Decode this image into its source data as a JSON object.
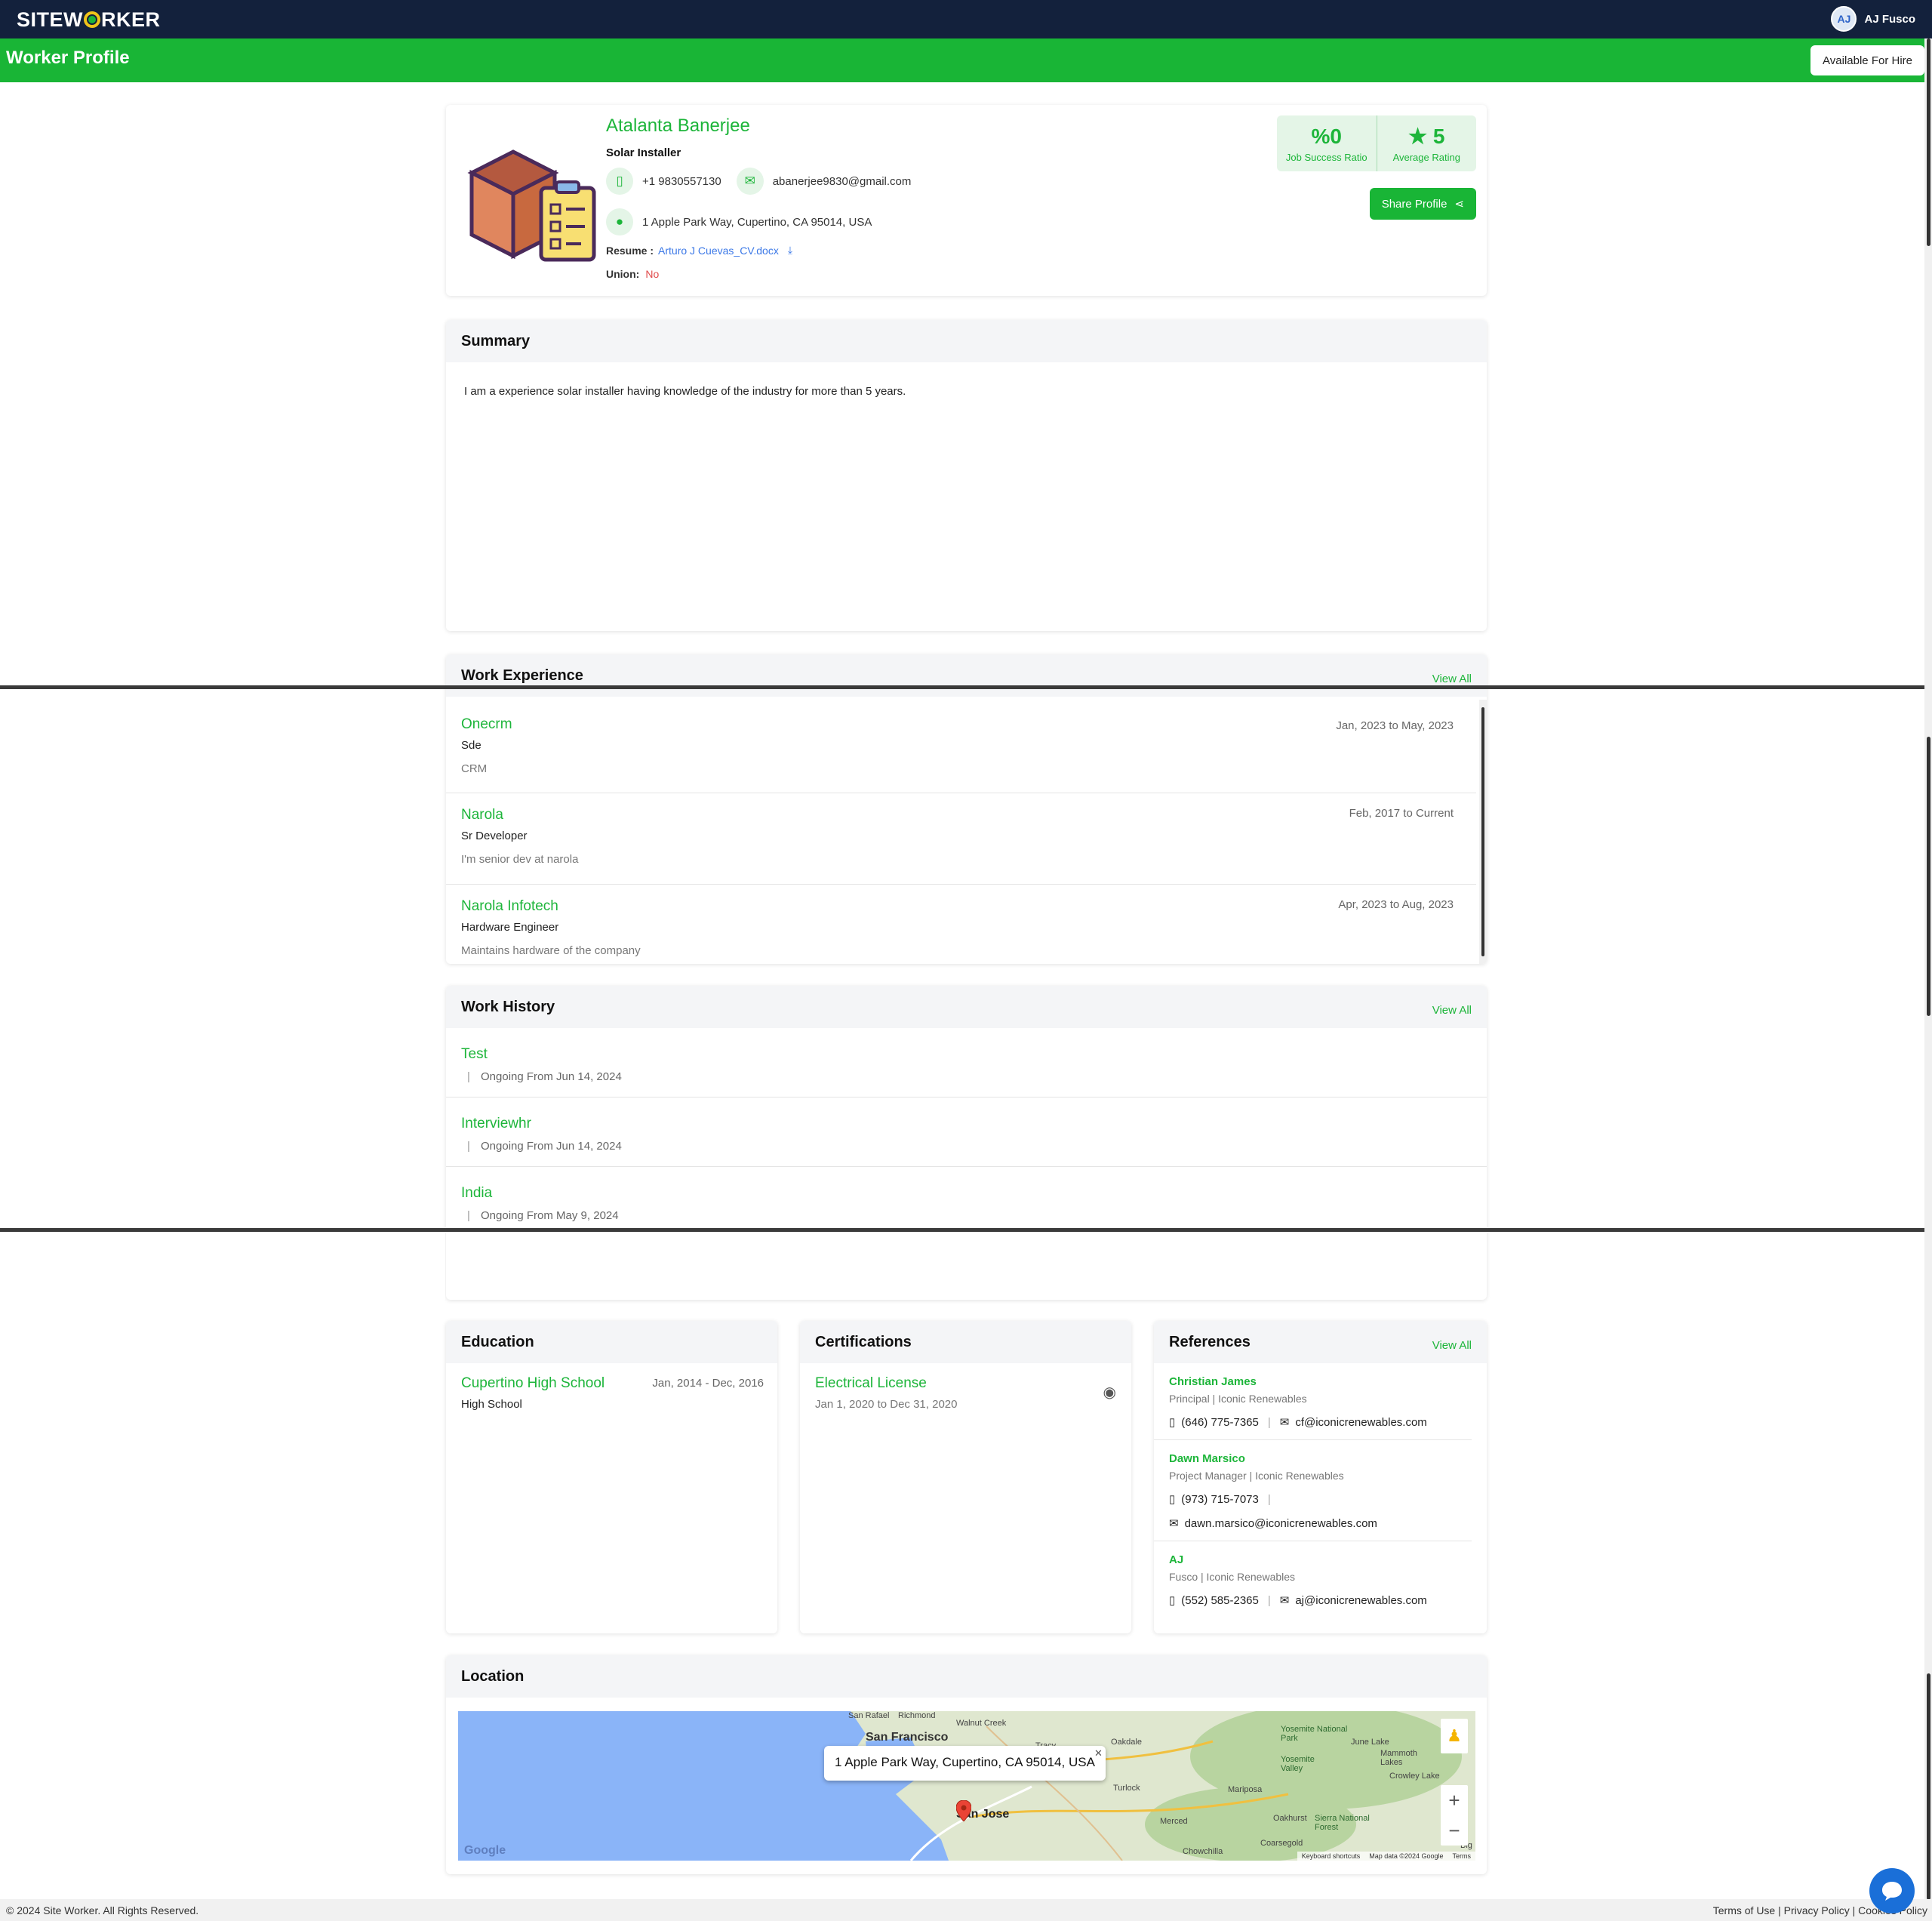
{
  "app": {
    "logo_text_1": "SITEW",
    "logo_text_2": "RKER",
    "user_name": "AJ Fusco",
    "user_initials": "AJ",
    "page_title": "Worker Profile",
    "availability": "Available For Hire",
    "accent_color": "#19b536"
  },
  "profile": {
    "name": "Atalanta Banerjee",
    "title": "Solar Installer",
    "phone": "+1 9830557130",
    "email": "abanerjee9830@gmail.com",
    "address": "1 Apple Park Way, Cupertino, CA 95014, USA",
    "resume_label": "Resume :",
    "resume_file": "Arturo J Cuevas_CV.docx",
    "union_label": "Union:",
    "union_value": "No",
    "job_success_value": "0",
    "job_success_label": "Job Success Ratio",
    "rating_value": "5",
    "rating_label": "Average Rating",
    "share_label": "Share Profile"
  },
  "summary": {
    "title": "Summary",
    "text": "I am a experience solar installer having knowledge of the industry for more than 5 years."
  },
  "work_experience": {
    "title": "Work Experience",
    "view_all": "View All",
    "items": [
      {
        "company": "Onecrm",
        "role": "Sde",
        "desc": "CRM",
        "dates": "Jan, 2023 to May, 2023"
      },
      {
        "company": "Narola",
        "role": "Sr Developer",
        "desc": "I'm senior dev at narola",
        "dates": "Feb, 2017 to Current"
      },
      {
        "company": "Narola Infotech",
        "role": "Hardware Engineer",
        "desc": "Maintains hardware of the company",
        "dates": "Apr, 2023 to Aug, 2023"
      }
    ]
  },
  "work_history": {
    "title": "Work History",
    "view_all": "View All",
    "items": [
      {
        "name": "Test",
        "status": "Ongoing From Jun 14, 2024"
      },
      {
        "name": "Interviewhr",
        "status": "Ongoing From Jun 14, 2024"
      },
      {
        "name": "India",
        "status": "Ongoing From May 9, 2024"
      }
    ]
  },
  "education": {
    "title": "Education",
    "items": [
      {
        "school": "Cupertino High School",
        "level": "High School",
        "dates": "Jan, 2014 - Dec, 2016"
      }
    ]
  },
  "certifications": {
    "title": "Certifications",
    "items": [
      {
        "name": "Electrical License",
        "dates": "Jan 1, 2020 to Dec 31, 2020"
      }
    ]
  },
  "references": {
    "title": "References",
    "view_all": "View All",
    "items": [
      {
        "name": "Christian James",
        "role": "Principal | Iconic Renewables",
        "phone": "(646) 775-7365",
        "email": "cf@iconicrenewables.com"
      },
      {
        "name": "Dawn Marsico",
        "role": "Project Manager | Iconic Renewables",
        "phone": "(973) 715-7073",
        "email": "dawn.marsico@iconicrenewables.com"
      },
      {
        "name": "AJ",
        "role": "Fusco | Iconic Renewables",
        "phone": "(552) 585-2365",
        "email": "aj@iconicrenewables.com"
      }
    ]
  },
  "location": {
    "title": "Location",
    "info_window": "1 Apple Park Way, Cupertino, CA 95014, USA",
    "map_labels": [
      "San Francisco",
      "San Jose",
      "Walnut Creek",
      "Tracy",
      "Oakdale",
      "Turlock",
      "Merced",
      "Mariposa",
      "Yosemite National Park",
      "Yosemite Valley",
      "June Lake",
      "Mammoth Lakes",
      "Crowley Lake",
      "Oakhurst",
      "Sierra National Forest",
      "Coarsegold",
      "Chowchilla",
      "San Rafael",
      "Richmond",
      "Big"
    ],
    "google_text": "Google",
    "map_footer": [
      "Keyboard shortcuts",
      "Map data ©2024 Google",
      "Terms"
    ]
  },
  "footer": {
    "copyright": "© 2024 Site Worker. All Rights Reserved.",
    "links": "Terms of Use | Privacy Policy | Cookies Policy"
  }
}
